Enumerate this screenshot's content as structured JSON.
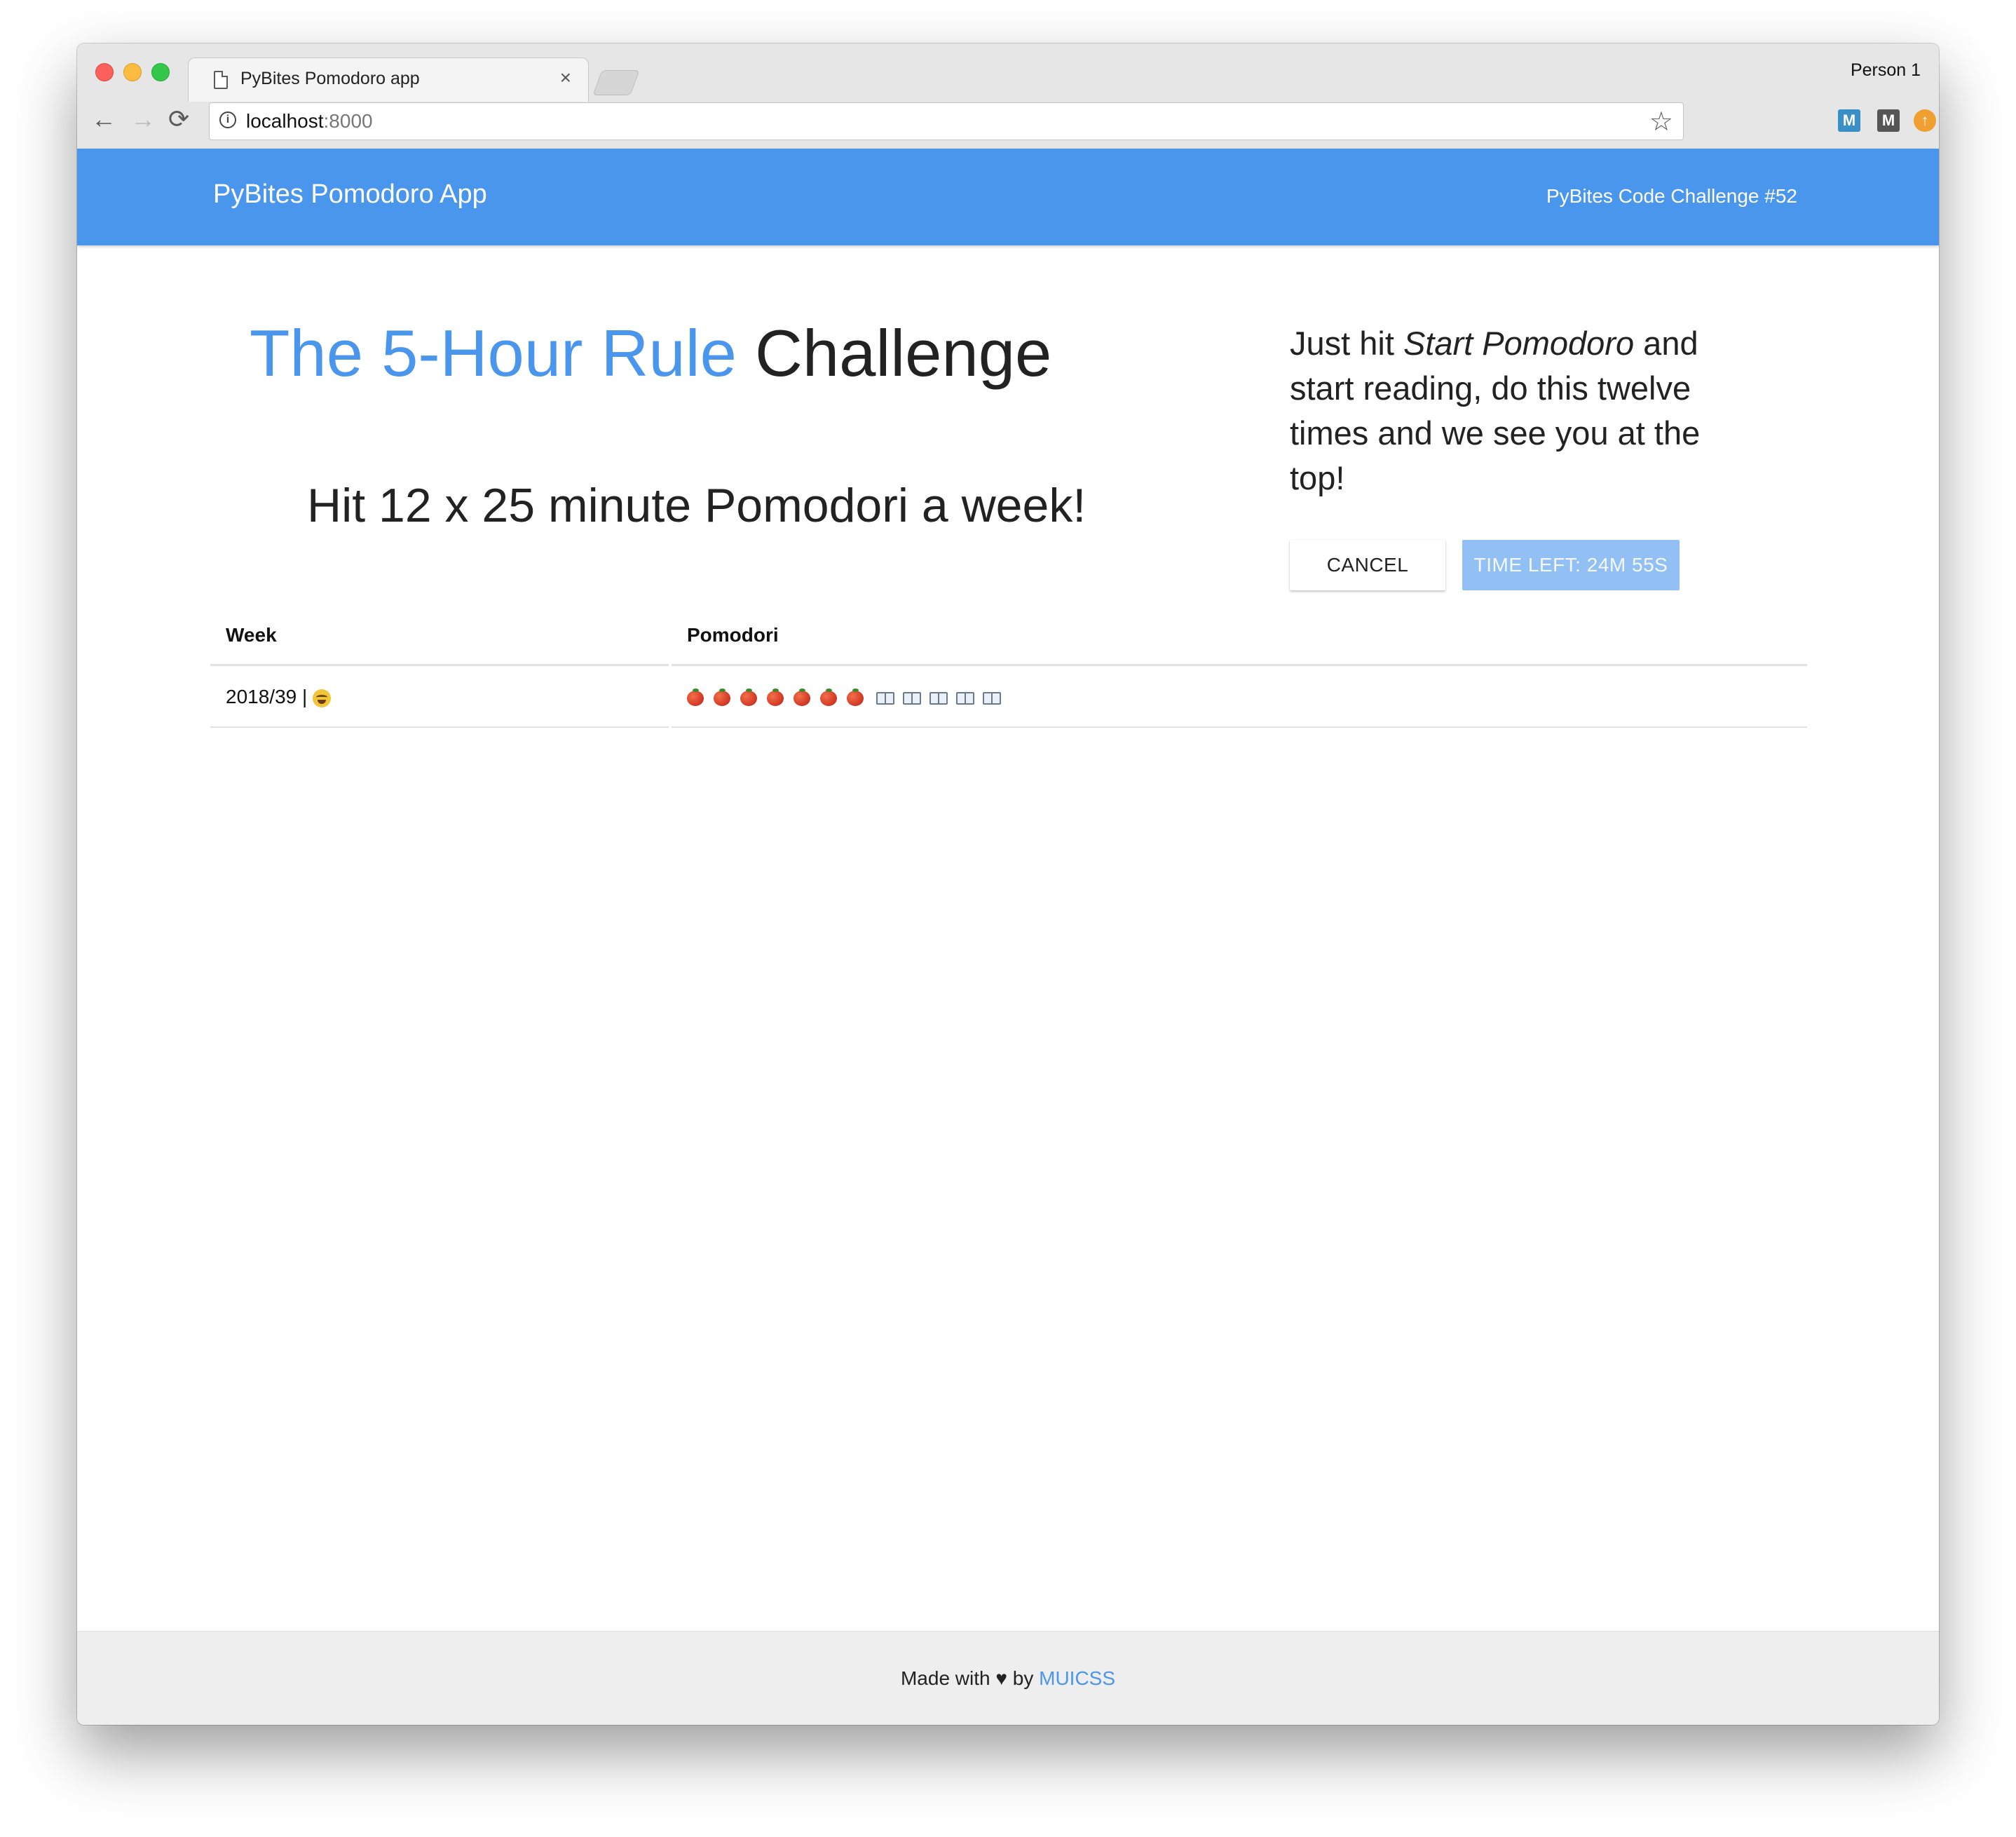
{
  "browser": {
    "tab_title": "PyBites Pomodoro app",
    "tab_close": "×",
    "profile": "Person 1",
    "url_host": "localhost",
    "url_port": ":8000",
    "icons": {
      "back": "←",
      "forward": "→",
      "reload": "⟳",
      "info": "i",
      "star": "☆"
    },
    "extensions": [
      "M",
      "M",
      "↑"
    ]
  },
  "app_bar": {
    "title": "PyBites Pomodoro App",
    "link": "PyBites Code Challenge #52"
  },
  "main": {
    "heading_accent": "The 5-Hour Rule",
    "heading_rest": " Challenge",
    "subheading": "Hit 12 x 25 minute Pomodori a week!",
    "instructions": {
      "before": "Just hit ",
      "emphasis": "Start Pomodoro",
      "after": " and start reading, do this twelve times and we see you at the top!"
    },
    "buttons": {
      "cancel": "CANCEL",
      "timer": "TIME LEFT: 24M 55S"
    }
  },
  "table": {
    "headers": [
      "Week",
      "Pomodori"
    ],
    "rows": [
      {
        "week": "2018/39 |",
        "week_icon": "rolling-laughing-face",
        "pomodori_done": 7,
        "pomodori_remaining": 5
      }
    ]
  },
  "footer": {
    "text_before": "Made with ♥ by ",
    "link": "MUICSS"
  },
  "colors": {
    "accent": "#4a96ec",
    "timer_button": "#92c0f4",
    "footer_bg": "#eeeeee"
  }
}
